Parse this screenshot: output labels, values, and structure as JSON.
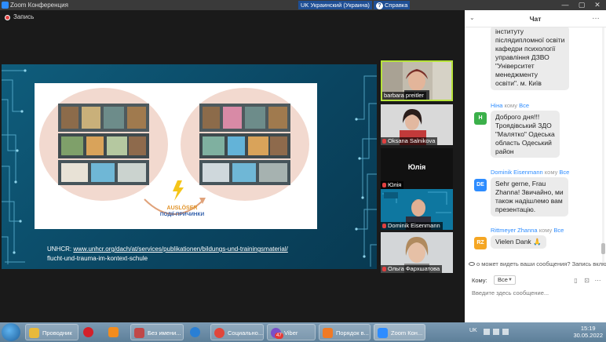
{
  "window": {
    "title": "Zoom Конференция",
    "language_indicator": "UK Украинский (Украина)",
    "help_label": "Справка"
  },
  "recording": {
    "label": "Запись"
  },
  "slide": {
    "trigger_de": "AUSLÖSER",
    "trigger_uk": "ПОДІЇ-ПРИЧИНКИ",
    "caption_prefix": "UNHCR: ",
    "caption_link": "www.unhcr.org/dach/at/services/publikationen/bildungs-und-trainingsmaterial/",
    "caption_line2": "flucht-und-trauma-im-kontext-schule"
  },
  "participants": [
    {
      "name": "barbara preitler",
      "active": true
    },
    {
      "name": "Oksana Salnikova"
    },
    {
      "name": "Юлія",
      "big_name": "Юлія",
      "video": false
    },
    {
      "name": "Dominik Eisenmann"
    },
    {
      "name": "Ольга Фархшатова"
    }
  ],
  "chat": {
    "title": "Чат",
    "messages": [
      {
        "lines": [
          "інституту",
          "післядипломної освіти",
          "кафедри психології",
          "управління ДЗВО",
          "\"Університет",
          "менеджменту",
          "освіти\". м. Київ"
        ]
      },
      {
        "sender": "Ніна",
        "to_word": "кому",
        "to": "Все",
        "avatar": "H",
        "avatar_color": "#3bb04a",
        "lines": [
          "Доброго дня!!!",
          "Троядівський ЗДО",
          "\"Малятко\" Одеська",
          "область Одеський",
          "район"
        ]
      },
      {
        "sender": "Dominik Eisenmann",
        "to_word": "кому",
        "to": "Все",
        "avatar": "DE",
        "avatar_color": "#2d8cff",
        "lines": [
          "Sehr gerne, Frau",
          "Zhanna! Звичайно, ми",
          "також надішлемо вам",
          "презентацію."
        ]
      },
      {
        "sender": "Rittmeyer Zhanna",
        "to_word": "кому",
        "to": "Все",
        "avatar": "RZ",
        "avatar_color": "#f5a623",
        "lines": [
          "Vielen Dank 🙏"
        ]
      }
    ],
    "notice": "о может видеть ваши сообщения? Запись включен",
    "to_label": "Кому:",
    "to_value": "Все",
    "input_placeholder": "Введите здесь сообщение..."
  },
  "taskbar": {
    "items": [
      {
        "label": "Проводник",
        "icon_color": "#e8b93a",
        "button": true
      },
      {
        "label": "",
        "icon_color": "#d3202a",
        "button": false
      },
      {
        "label": "",
        "icon_color": "#f28c1e",
        "button": false
      },
      {
        "label": "Без имени...",
        "icon_color": "#c04848",
        "button": true
      },
      {
        "label": "",
        "icon_color": "#2a7fd4",
        "button": false
      },
      {
        "label": "Социально...",
        "icon_color": "#e0463b",
        "button": true
      },
      {
        "label": "Viber",
        "icon_color": "#7a4ec8",
        "button": true,
        "badge": "47"
      },
      {
        "label": "Порядок в...",
        "icon_color": "#f07a25",
        "button": true
      },
      {
        "label": "Zoom Кон...",
        "icon_color": "#2d8cff",
        "button": true
      }
    ],
    "tray_lang": "UK",
    "time": "15:19",
    "date": "30.05.2022"
  }
}
